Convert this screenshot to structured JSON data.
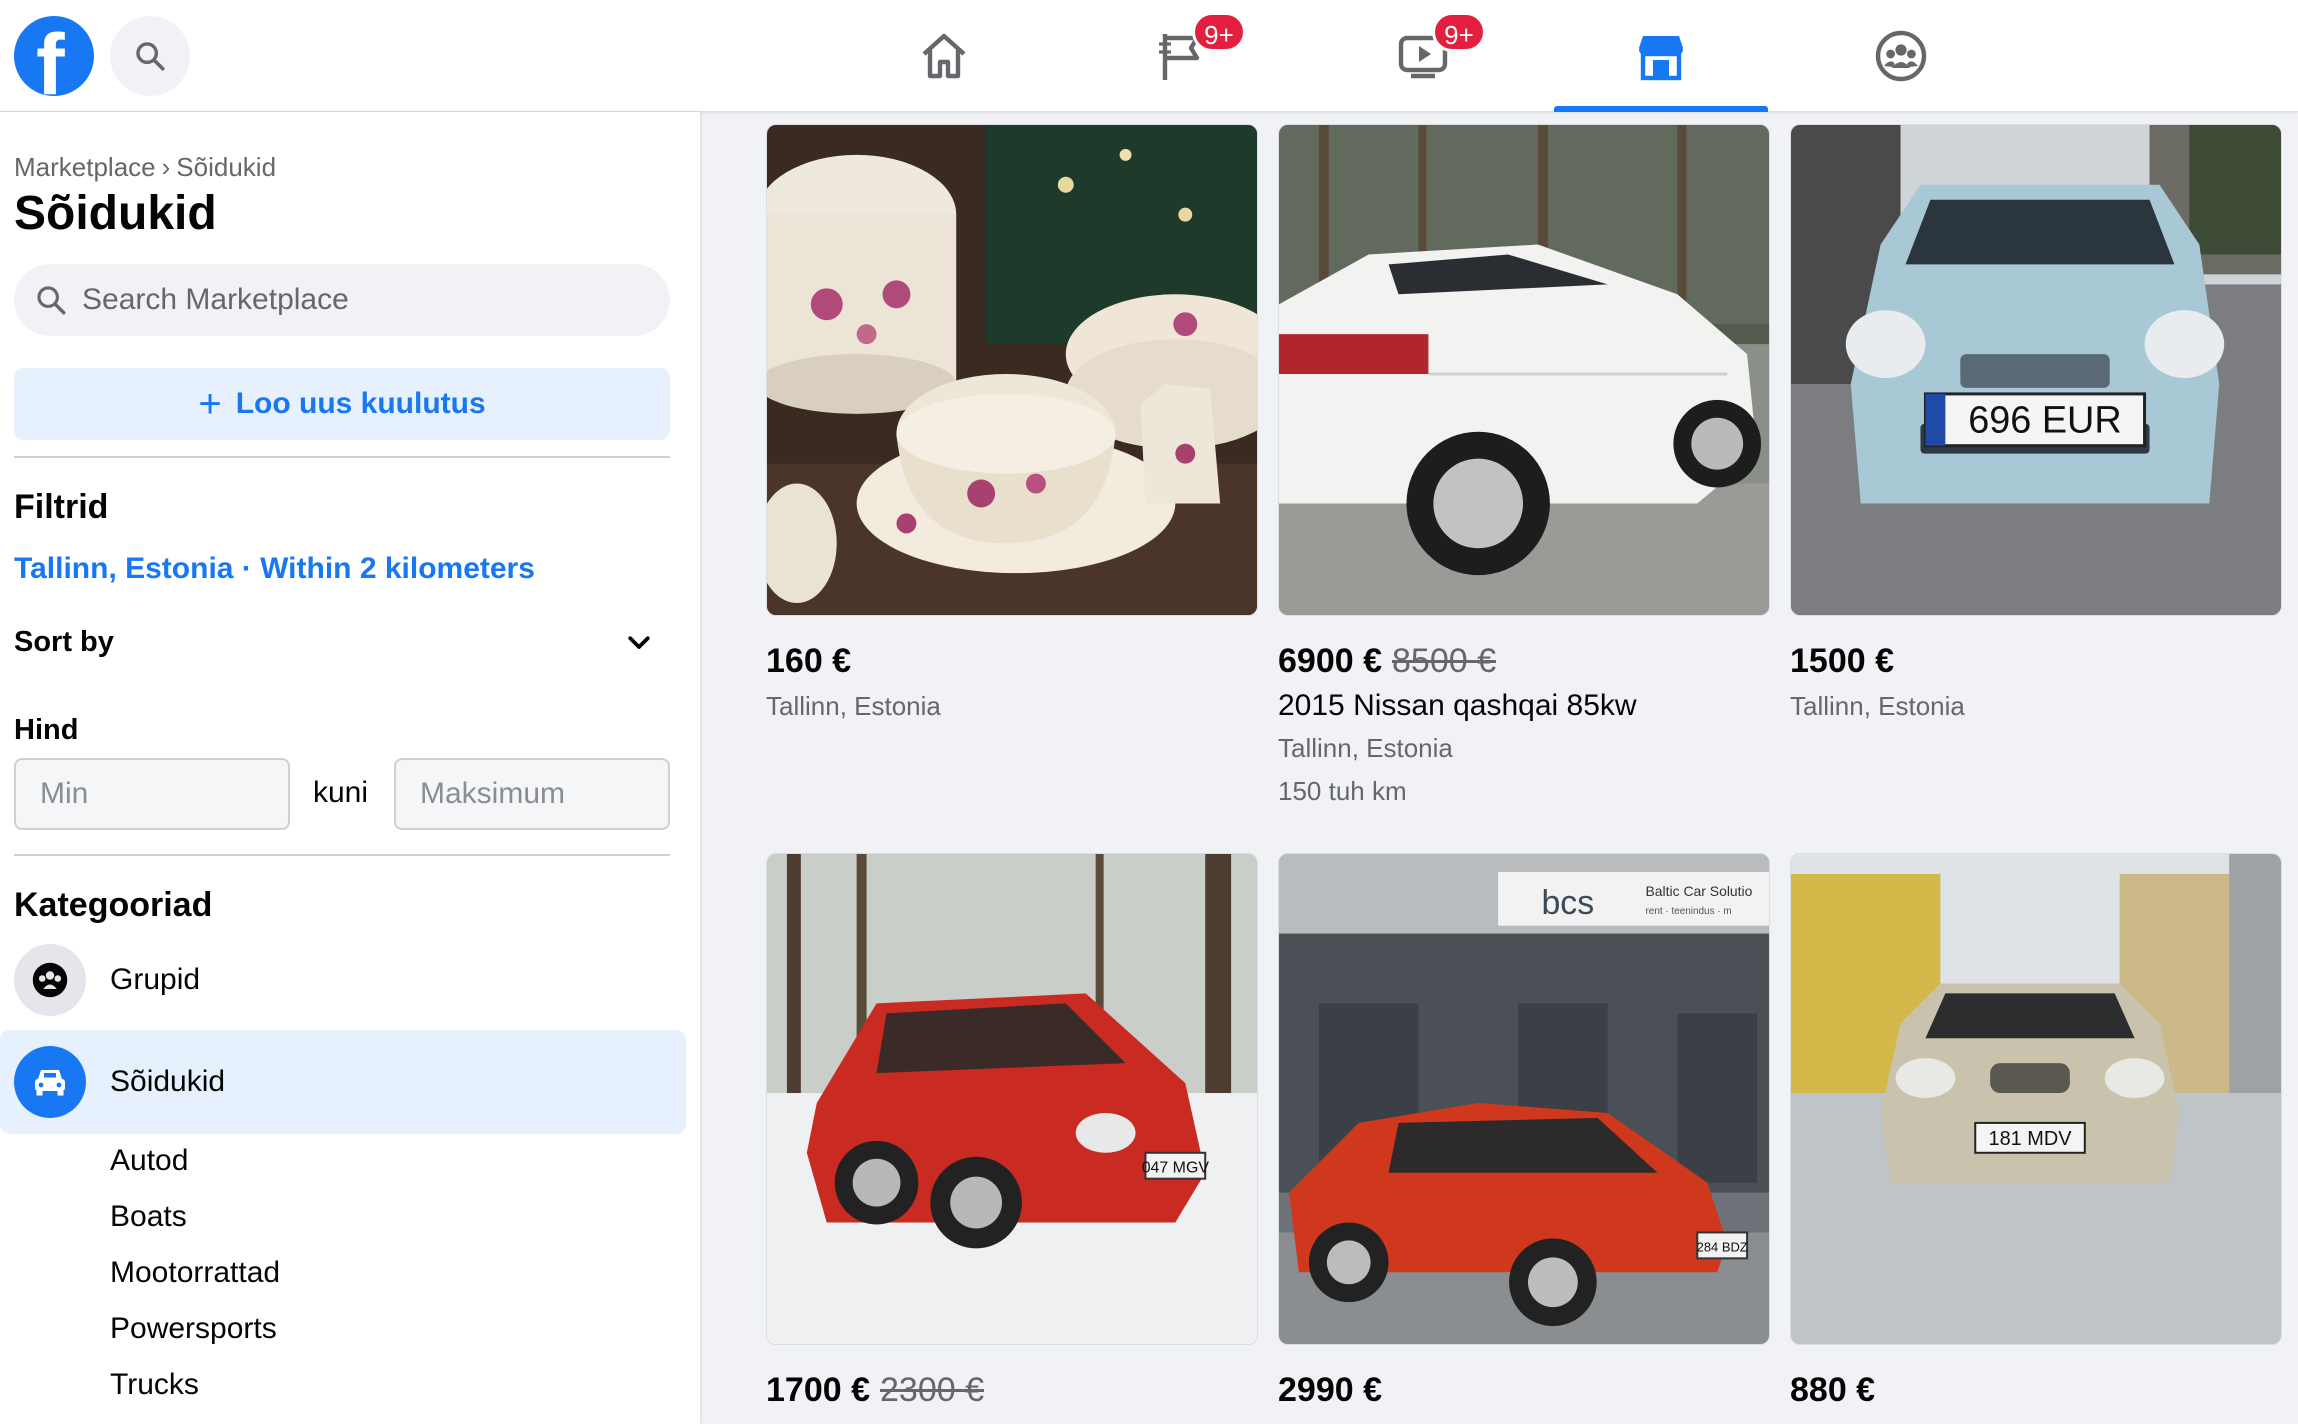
{
  "topbar": {
    "logo": "facebook-logo",
    "nav": [
      {
        "name": "home",
        "icon": "home-icon",
        "badge": ""
      },
      {
        "name": "pages",
        "icon": "flag-icon",
        "badge": "9+"
      },
      {
        "name": "watch",
        "icon": "video-icon",
        "badge": "9+"
      },
      {
        "name": "marketplace",
        "icon": "marketplace-icon",
        "badge": "",
        "active": true
      },
      {
        "name": "groups",
        "icon": "groups-icon",
        "badge": ""
      }
    ]
  },
  "sidebar": {
    "breadcrumb": {
      "root": "Marketplace",
      "separator": "›",
      "current": "Sõidukid"
    },
    "title": "Sõidukid",
    "search_placeholder": "Search Marketplace",
    "create_label": "Loo uus kuulutus",
    "filters_title": "Filtrid",
    "location": "Tallinn, Estonia · Within 2 kilometers",
    "sort_label": "Sort by",
    "price_title": "Hind",
    "price_min_placeholder": "Min",
    "price_to": "kuni",
    "price_max_placeholder": "Maksimum",
    "categories_title": "Kategooriad",
    "categories": [
      {
        "label": "Grupid",
        "icon": "groups-icon"
      },
      {
        "label": "Sõidukid",
        "icon": "car-icon",
        "active": true
      }
    ],
    "subcategories": [
      "Autod",
      "Boats",
      "Mootorrattad",
      "Powersports",
      "Trucks"
    ]
  },
  "listings": [
    {
      "price": "160 €",
      "old_price": "",
      "title": "",
      "location": "Tallinn, Estonia",
      "meta": "",
      "image": "porcelain dishes"
    },
    {
      "price": "6900 €",
      "old_price": "8500 €",
      "title": "2015 Nissan qashqai 85kw",
      "location": "Tallinn, Estonia",
      "meta": "150 tuh km",
      "image": "white nissan"
    },
    {
      "price": "1500 €",
      "old_price": "",
      "title": "",
      "location": "Tallinn, Estonia",
      "meta": "",
      "image": "blue toyota",
      "plate": "696 EUR"
    },
    {
      "price": "1700 €",
      "old_price": "2300 €",
      "title": "",
      "location": "",
      "meta": "",
      "image": "red volkswagen",
      "plate": "047 MGV"
    },
    {
      "price": "2990 €",
      "old_price": "",
      "title": "",
      "location": "",
      "meta": "",
      "image": "red seat",
      "sign": "bcs",
      "sign_sub": "Baltic Car Solutio",
      "sign_sub2": "rent · teenindus · m",
      "plate": "284 BDZ"
    },
    {
      "price": "880 €",
      "old_price": "",
      "title": "",
      "location": "",
      "meta": "",
      "image": "silver mazda",
      "plate": "181 MDV"
    }
  ],
  "colors": {
    "accent": "#1877f2",
    "badge": "#e41e3f",
    "muted": "#65676b"
  }
}
